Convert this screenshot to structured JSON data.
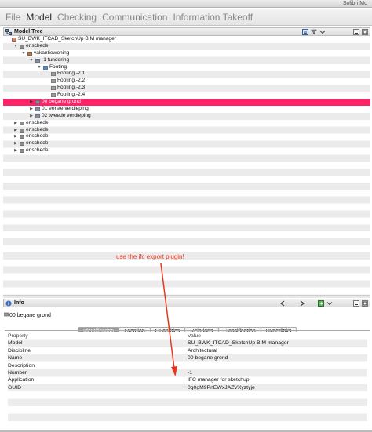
{
  "app_title": "Solibri Mo",
  "menu": [
    {
      "label": "File",
      "active": false
    },
    {
      "label": "Model",
      "active": true
    },
    {
      "label": "Checking",
      "active": false
    },
    {
      "label": "Communication",
      "active": false
    },
    {
      "label": "Information Takeoff",
      "active": false
    }
  ],
  "model_tree": {
    "title": "Model Tree",
    "rows": [
      {
        "label": "SU_BWK_ITCAD_SketchUp BIM manager",
        "depth": 0,
        "toggle": "none",
        "icon": "project",
        "selected": false
      },
      {
        "label": "enschede",
        "depth": 1,
        "toggle": "expanded",
        "icon": "site",
        "selected": false
      },
      {
        "label": "vakantiewoning",
        "depth": 2,
        "toggle": "expanded",
        "icon": "building",
        "selected": false
      },
      {
        "label": "-1 fundering",
        "depth": 3,
        "toggle": "expanded",
        "icon": "storey",
        "selected": false
      },
      {
        "label": "Footing",
        "depth": 4,
        "toggle": "expanded",
        "icon": "folder",
        "selected": false
      },
      {
        "label": "Footing.-2.1",
        "depth": 5,
        "toggle": "none",
        "icon": "element",
        "selected": false
      },
      {
        "label": "Footing.-2.2",
        "depth": 5,
        "toggle": "none",
        "icon": "element",
        "selected": false
      },
      {
        "label": "Footing.-2.3",
        "depth": 5,
        "toggle": "none",
        "icon": "element",
        "selected": false
      },
      {
        "label": "Footing.-2.4",
        "depth": 5,
        "toggle": "none",
        "icon": "element",
        "selected": false
      },
      {
        "label": "00 begane grond",
        "depth": 3,
        "toggle": "collapsed",
        "icon": "storey",
        "selected": true
      },
      {
        "label": "01 eerste verdieping",
        "depth": 3,
        "toggle": "collapsed",
        "icon": "storey",
        "selected": false
      },
      {
        "label": "02 tweede verdieping",
        "depth": 3,
        "toggle": "collapsed",
        "icon": "storey",
        "selected": false
      },
      {
        "label": "enschede",
        "depth": 1,
        "toggle": "collapsed",
        "icon": "site",
        "selected": false
      },
      {
        "label": "enschede",
        "depth": 1,
        "toggle": "collapsed",
        "icon": "site",
        "selected": false
      },
      {
        "label": "enschede",
        "depth": 1,
        "toggle": "collapsed",
        "icon": "site",
        "selected": false
      },
      {
        "label": "enschede",
        "depth": 1,
        "toggle": "collapsed",
        "icon": "site",
        "selected": false
      },
      {
        "label": "enschede",
        "depth": 1,
        "toggle": "collapsed",
        "icon": "site",
        "selected": false
      }
    ]
  },
  "info": {
    "title": "Info",
    "current": "00 begane grond",
    "tabs": [
      {
        "label": "Identification",
        "active": true
      },
      {
        "label": "Location",
        "active": false
      },
      {
        "label": "Quantities",
        "active": false
      },
      {
        "label": "Relations",
        "active": false
      },
      {
        "label": "Classification",
        "active": false
      },
      {
        "label": "Hyperlinks",
        "active": false
      }
    ],
    "columns": [
      "Property",
      "Value"
    ],
    "rows": [
      [
        "Model",
        "SU_BWK_ITCAD_SketchUp BIM manager"
      ],
      [
        "Discipline",
        "Architectural"
      ],
      [
        "Name",
        "00 begane grond"
      ],
      [
        "Description",
        ""
      ],
      [
        "Number",
        "-1"
      ],
      [
        "Application",
        "IFC manager for sketchup"
      ],
      [
        "GUID",
        "0g0gM9PnEWxJAZVXyztyje"
      ]
    ]
  },
  "annotation": {
    "text": "use the ifc export plugin!",
    "color": "#e8361f"
  },
  "colors": {
    "selection": "#ff2266",
    "annotation": "#e8361f",
    "active_tab": "#9a9a9a"
  }
}
